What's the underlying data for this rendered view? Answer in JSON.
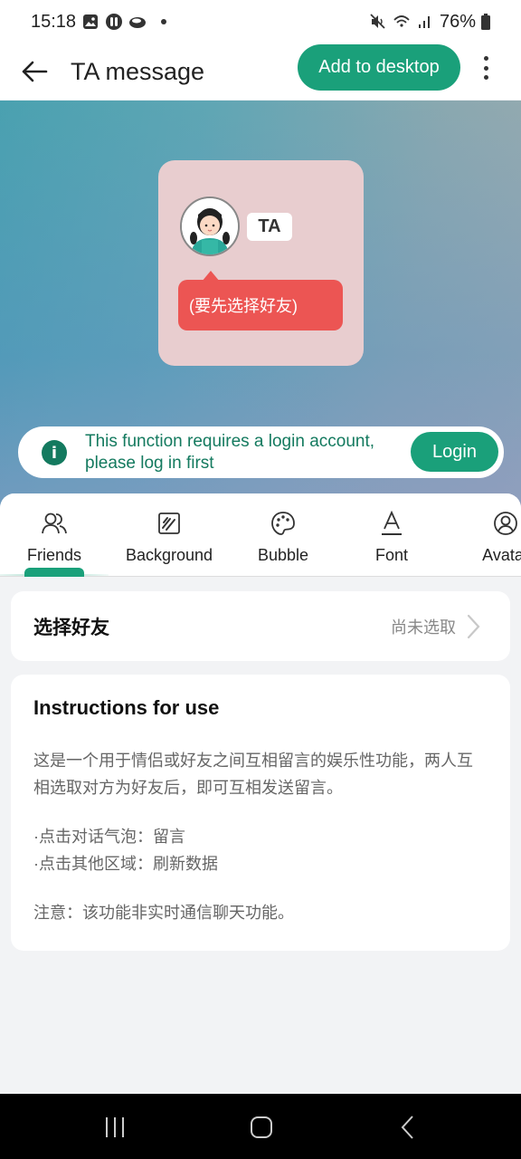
{
  "status_bar": {
    "time": "15:18",
    "battery": "76%",
    "left_icons": [
      "gallery-icon",
      "app-icon",
      "cloud-icon",
      "dot-icon"
    ],
    "right_icons": [
      "mute-icon",
      "wifi-icon",
      "signal-icon",
      "battery-icon"
    ]
  },
  "app_bar": {
    "title": "TA message",
    "add_to_desktop_label": "Add to desktop",
    "back_icon": "arrow-left-icon",
    "more_icon": "more-vertical-icon"
  },
  "preview": {
    "name_tag": "TA",
    "bubble_text": "(要先选择好友)",
    "avatar": "girl-avatar"
  },
  "login_banner": {
    "message": "This function requires a login account, please log in first",
    "login_label": "Login",
    "icon": "info-icon"
  },
  "tabs": [
    {
      "label": "Friends",
      "icon": "friends-icon",
      "active": true
    },
    {
      "label": "Background",
      "icon": "background-icon",
      "active": false
    },
    {
      "label": "Bubble",
      "icon": "palette-icon",
      "active": false
    },
    {
      "label": "Font",
      "icon": "font-icon",
      "active": false
    },
    {
      "label": "Avatar",
      "icon": "avatar-icon",
      "active": false
    }
  ],
  "select_friend": {
    "label": "选择好友",
    "value": "尚未选取"
  },
  "instructions": {
    "title": "Instructions for use",
    "paragraph": "这是一个用于情侣或好友之间互相留言的娱乐性功能，两人互相选取对方为好友后，即可互相发送留言。",
    "bullet_1": "·点击对话气泡：留言",
    "bullet_2": "·点击其他区域：刷新数据",
    "note": "注意：该功能非实时通信聊天功能。"
  },
  "colors": {
    "accent": "#1aa07a",
    "accent_dark": "#147a5f",
    "bubble": "#ec5553",
    "widget_bg": "#e8cdcf"
  }
}
